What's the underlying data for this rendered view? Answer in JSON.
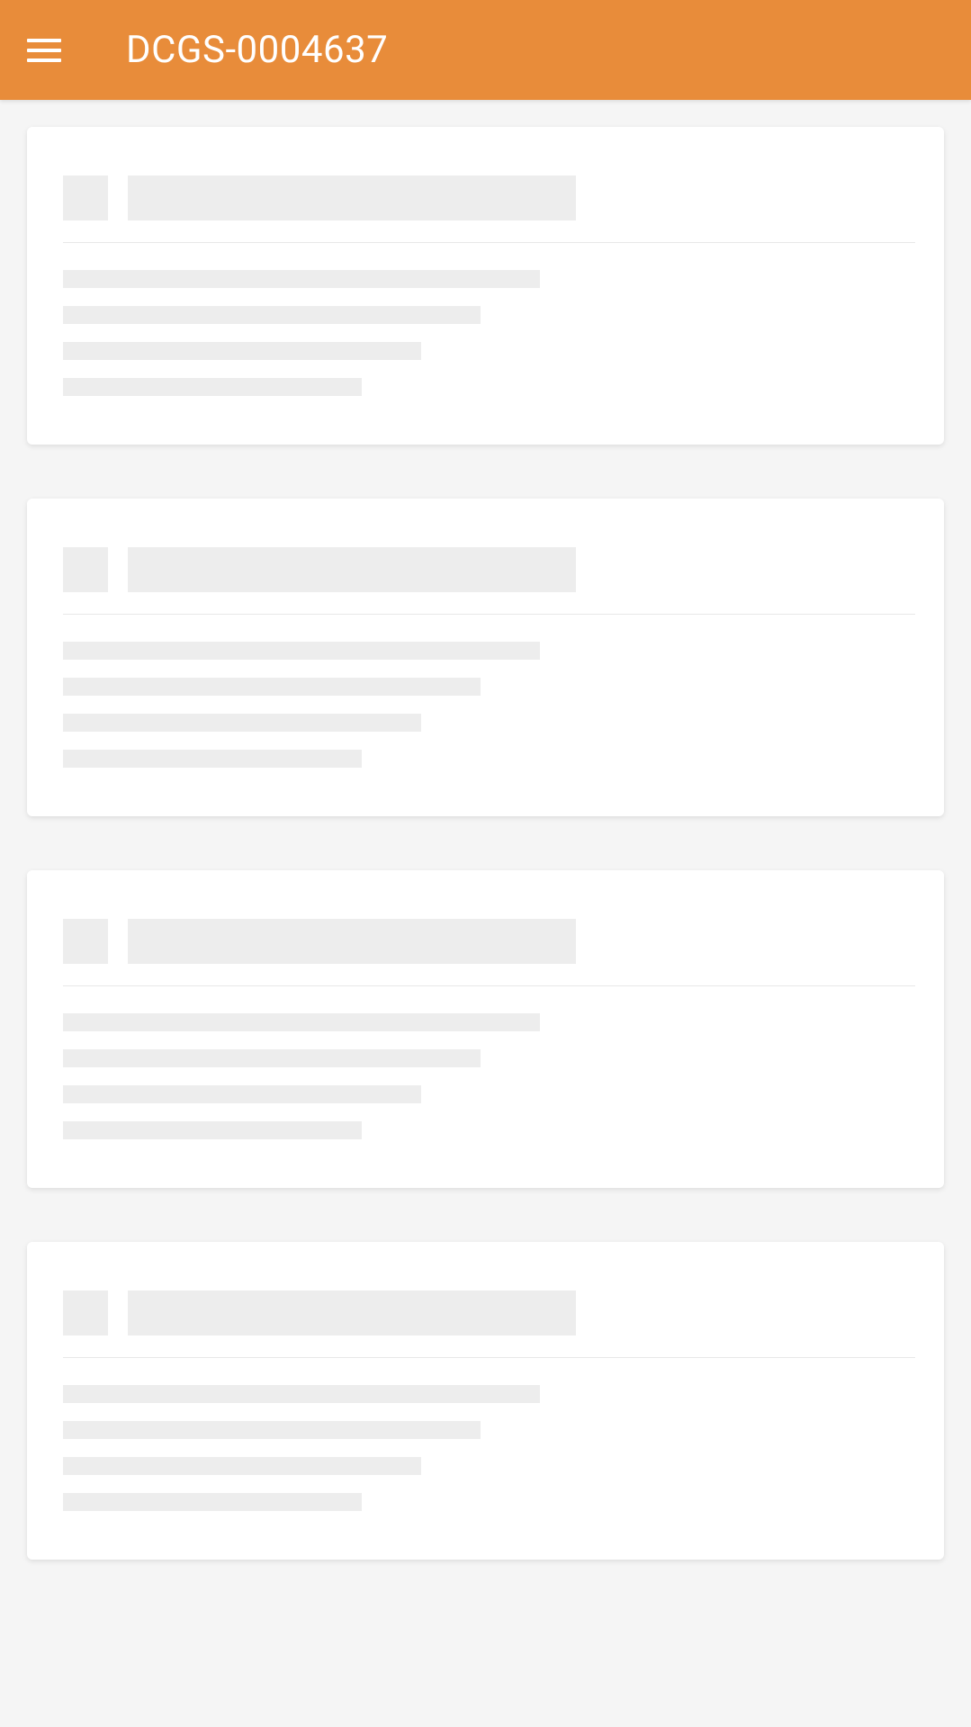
{
  "header": {
    "title": "DCGS-0004637"
  },
  "colors": {
    "app_bar": "#e88c3a",
    "background": "#f5f5f5",
    "card": "#ffffff",
    "skeleton": "#ededed"
  },
  "cards": [
    {
      "loading": true
    },
    {
      "loading": true
    },
    {
      "loading": true
    },
    {
      "loading": true
    }
  ]
}
